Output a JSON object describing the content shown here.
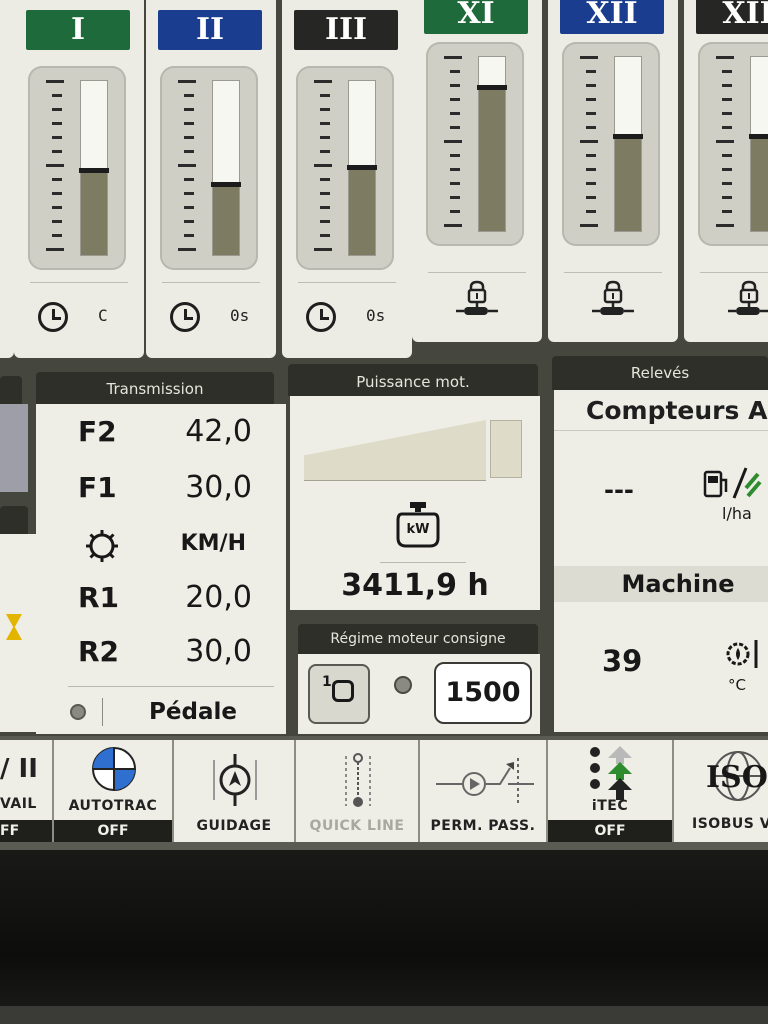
{
  "valves": [
    {
      "label": "I",
      "color": "#1f6a3a",
      "fill": 0.48,
      "foot": "C",
      "icon": "clock-icon"
    },
    {
      "label": "II",
      "color": "#1a3d8f",
      "fill": 0.4,
      "foot": "0s",
      "icon": "clock-icon"
    },
    {
      "label": "III",
      "color": "#262624",
      "fill": 0.5,
      "foot": "0s",
      "icon": "clock-icon"
    },
    {
      "label": "XI",
      "color": "#1f6a3a",
      "fill": 0.82,
      "foot": "",
      "icon": "lock-cylinder-icon"
    },
    {
      "label": "XII",
      "color": "#1a3d8f",
      "fill": 0.54,
      "foot": "",
      "icon": "lock-cylinder-icon"
    },
    {
      "label": "XII",
      "color": "#262624",
      "fill": 0.54,
      "foot": "",
      "icon": "lock-cylinder-icon"
    }
  ],
  "transmission": {
    "title": "Transmission",
    "rows": [
      {
        "label": "F2",
        "value": "42,0"
      },
      {
        "label": "F1",
        "value": "30,0"
      },
      {
        "label": "",
        "value": "KM/H"
      },
      {
        "label": "R1",
        "value": "20,0"
      },
      {
        "label": "R2",
        "value": "30,0"
      }
    ],
    "pedal": "Pédale"
  },
  "engine_power": {
    "title": "Puissance mot.",
    "icon_text": "kW",
    "hours": "3411,9 h"
  },
  "engine_speed": {
    "title": "Régime moteur consigne",
    "value": "1500",
    "button_icon_text": "1"
  },
  "readings": {
    "title": "Relevés",
    "counters": "Compteurs A",
    "fuel_value": "---",
    "fuel_unit": "l/ha",
    "machine": "Machine",
    "temp_value": "39",
    "temp_unit": "°C"
  },
  "buttons": [
    {
      "label": "VAIL",
      "status": "FF",
      "top_text": "/ II"
    },
    {
      "label": "AUTOTRAC",
      "status": "OFF"
    },
    {
      "label": "GUIDAGE",
      "status": ""
    },
    {
      "label": "QUICK LINE",
      "status": ""
    },
    {
      "label": "PERM. PASS.",
      "status": ""
    },
    {
      "label": "iTEC",
      "status": "OFF"
    },
    {
      "label": "ISOBUS V",
      "status": "",
      "top_text": "ISO"
    }
  ],
  "colors": {
    "panel_bg": "#eeeee6",
    "screen_bg": "#45463e",
    "header_bg": "#2e2f29",
    "gauge_fill": "#7d7c62",
    "itec_green": "#2e8b2e"
  }
}
